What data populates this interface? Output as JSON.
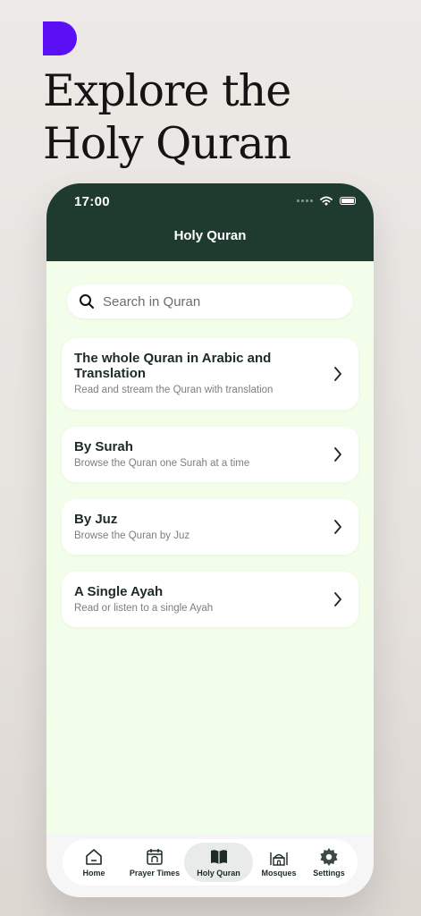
{
  "promo": {
    "title_line1": "Explore the",
    "title_line2": "Holy Quran"
  },
  "status_bar": {
    "time": "17:00"
  },
  "header": {
    "title": "Holy Quran"
  },
  "search": {
    "placeholder": "Search in Quran"
  },
  "cards": [
    {
      "title_line1": "The whole Quran in Arabic and",
      "title_line2": "Translation",
      "subtitle": "Read and stream the Quran with translation"
    },
    {
      "title": "By Surah",
      "subtitle": "Browse the Quran one Surah at a time"
    },
    {
      "title": "By Juz",
      "subtitle": "Browse the Quran by Juz"
    },
    {
      "title": "A Single Ayah",
      "subtitle": "Read or listen to a single Ayah"
    }
  ],
  "tabs": [
    {
      "label": "Home",
      "icon": "home-icon"
    },
    {
      "label": "Prayer Times",
      "icon": "calendar-icon"
    },
    {
      "label": "Holy Quran",
      "icon": "book-icon",
      "active": true
    },
    {
      "label": "Mosques",
      "icon": "mosque-icon"
    },
    {
      "label": "Settings",
      "icon": "gear-icon"
    }
  ],
  "colors": {
    "brand": "#5b0ff5",
    "header_bg": "#1f3a2e",
    "content_bg": "#f2fdea"
  }
}
